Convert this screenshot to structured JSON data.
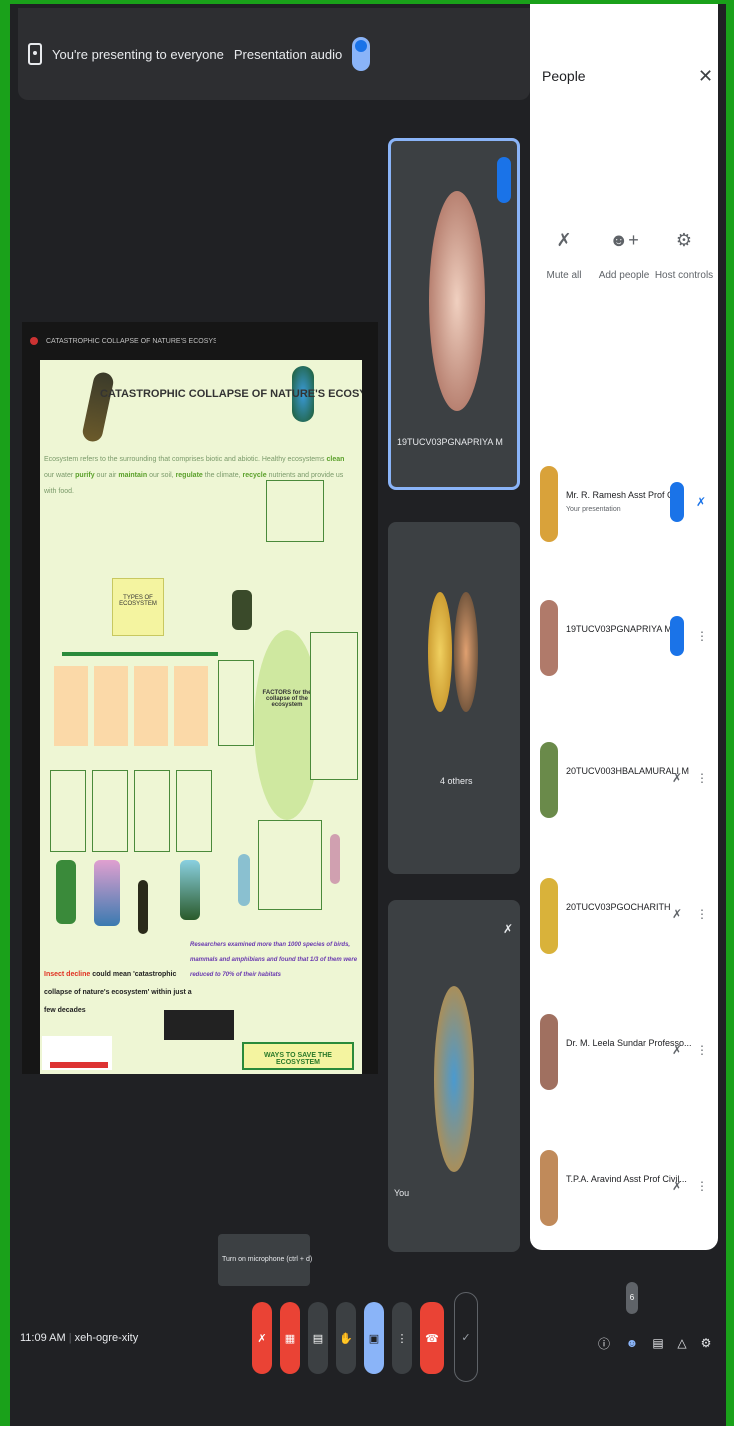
{
  "presenting_bar": {
    "status_text": "You're presenting to everyone",
    "audio_label": "Presentation audio"
  },
  "slide": {
    "tab_title": "CATASTROPHIC COLLAPSE OF NATURE'S ECOSYSTEM",
    "title": "CATASTROPHIC COLLAPSE OF NATURE'S ECOSYSTEM",
    "intro_line1": "Ecosystem refers to the surrounding that comprises biotic and abiotic. Healthy ecosystems",
    "kw_clean": "clean",
    "mid_line1": "our water",
    "kw_purify": "purify",
    "end_line1": "our air",
    "kw_maintain": "maintain",
    "mid_line2": "our soil,",
    "kw_regulate": "regulate",
    "mid_line3": "the climate,",
    "kw_recycle": "recycle",
    "end_line2": "nutrients and provide us with food.",
    "types_label": "TYPES OF ECOSYSTEM",
    "factors_label": "FACTORS for the collapse of the ecosystem",
    "insect_decline": "Insect decline",
    "collapse_text": "could mean 'catastrophic collapse of nature's ecosystem' within just a few decades",
    "research_text": "Researchers examined more than 1000 species of birds, mammals and amphibians and found that 1/3 of them were reduced to 70% of their habitats",
    "ways_banner": "WAYS TO SAVE THE ECOSYSTEM"
  },
  "tiles": [
    {
      "name": "19TUCV03PGNAPRIYA M",
      "badge": "speaking"
    },
    {
      "name": "4 others"
    },
    {
      "name": "You"
    }
  ],
  "people_panel": {
    "title": "People",
    "actions": [
      {
        "icon": "mic-off-icon",
        "label": "Mute all"
      },
      {
        "icon": "add-person-icon",
        "label": "Add people"
      },
      {
        "icon": "host-controls-icon",
        "label": "Host controls"
      }
    ],
    "participants": [
      {
        "name": "Mr. R. Ramesh Asst Prof Ci...",
        "sub": "Your presentation",
        "state": "speaking",
        "avatar_color": "#d9a23a"
      },
      {
        "name": "19TUCV03PGNAPRIYA M",
        "sub": "",
        "state": "speaking",
        "avatar_color": "#b07a6a"
      },
      {
        "name": "20TUCV003HBALAMURALI M",
        "sub": "",
        "state": "muted",
        "avatar_color": "#6a8a4a"
      },
      {
        "name": "20TUCV03PGOCHARITH",
        "sub": "",
        "state": "muted",
        "avatar_color": "#d9b23a"
      },
      {
        "name": "Dr. M. Leela Sundar Professo...",
        "sub": "",
        "state": "muted",
        "avatar_color": "#a07060"
      },
      {
        "name": "T.P.A. Aravind Asst Prof Civil...",
        "sub": "",
        "state": "muted",
        "avatar_color": "#c08a5a"
      }
    ]
  },
  "tooltip": {
    "text": "Turn on microphone (ctrl + d)"
  },
  "bottom_bar": {
    "time": "11:09 AM",
    "meeting_code": "xeh-ogre-xity",
    "people_count": "6"
  },
  "colors": {
    "accent_blue": "#1a73e8",
    "light_blue": "#8ab4f8",
    "red": "#ea4335",
    "background": "#202124",
    "desktop_green": "#1aa11a"
  }
}
